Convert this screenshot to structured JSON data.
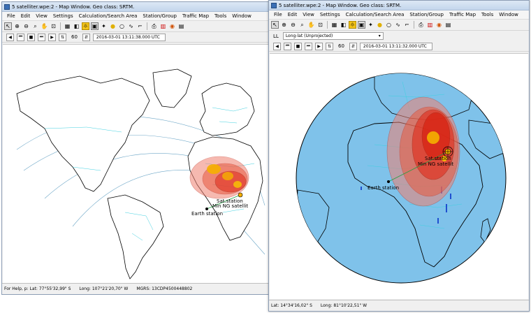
{
  "window_left": {
    "title": "5 satelliter.wpe:2 - Map Window. Geo class: SRTM.",
    "menu": [
      "File",
      "Edit",
      "View",
      "Settings",
      "Calculation/Search Area",
      "Station/Group",
      "Traffic Map",
      "Tools",
      "Window"
    ],
    "speed": "60",
    "time": "2016-03-01 13:11:38.000 UTC",
    "earth_station_label": "Earth station",
    "sat_station_label": "Sat.station",
    "satellite_label": "Min NG satellit",
    "status": {
      "help": "For Help, p: Lat: 77°55'32,99\" S",
      "long": "Long: 107°21'20,70\" W",
      "mgrs": "MGRS: 13CDP4500448802"
    }
  },
  "window_right": {
    "title": "5 satelliter.wpe:2 - Map Window. Geo class: SRTM.",
    "menu": [
      "File",
      "Edit",
      "View",
      "Settings",
      "Calculation/Search Area",
      "Station/Group",
      "Traffic Map",
      "Tools",
      "Window"
    ],
    "projection_label": "LL",
    "projection_value": "Long-lat (Unprojected)",
    "speed": "60",
    "time": "2016-03-01 13:11:32.000 UTC",
    "earth_station_label": "Earth station",
    "sat_station_label": "Sat.station",
    "satellite_label": "Min NG satellit",
    "status": {
      "lat": "Lat: 14°34'16,02\" S",
      "long": "Long: 81°10'22,51\" W"
    }
  },
  "toolbar_icons": [
    "pointer-icon",
    "zoom-in-icon",
    "zoom-out-icon",
    "zoom-window-icon",
    "pan-icon",
    "zoom-all-icon",
    "map-icon",
    "layers-icon",
    "grid-icon",
    "overlay-icon",
    "pin-icon",
    "circle-icon",
    "measure-icon",
    "curve-icon",
    "line-icon",
    "print-icon",
    "chart-icon",
    "palette-icon",
    "globe-icon",
    "table-icon"
  ],
  "colors": {
    "ocean": "#7fc2ea",
    "land": "#ffffff",
    "coverage": "#e03020",
    "coverage_core": "#f5a000",
    "border_cyan": "#3fd0e0",
    "coastline": "#000000"
  }
}
